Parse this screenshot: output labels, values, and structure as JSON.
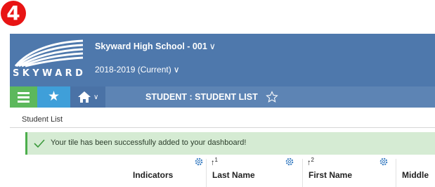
{
  "annotation": {
    "step_number": "4"
  },
  "header": {
    "logo_text": "SKYWARD",
    "school": "Skyward High School - 001",
    "year": "2018-2019 (Current)"
  },
  "nav": {
    "page_title": "STUDENT : STUDENT LIST"
  },
  "breadcrumb": "Student List",
  "notice": {
    "message": "Your tile has been successfully added to your dashboard!"
  },
  "grid": {
    "columns": [
      {
        "label": "Indicators",
        "sort": ""
      },
      {
        "label": "Last Name",
        "sort": "1"
      },
      {
        "label": "First Name",
        "sort": "2"
      },
      {
        "label": "Middle",
        "sort": ""
      }
    ]
  },
  "colors": {
    "header_bg": "#4e78ac",
    "menu_green": "#5cb85c",
    "favorites_blue": "#3f9fd9",
    "notice_bg": "#d5ebd3",
    "step_badge_red": "#e81414"
  }
}
